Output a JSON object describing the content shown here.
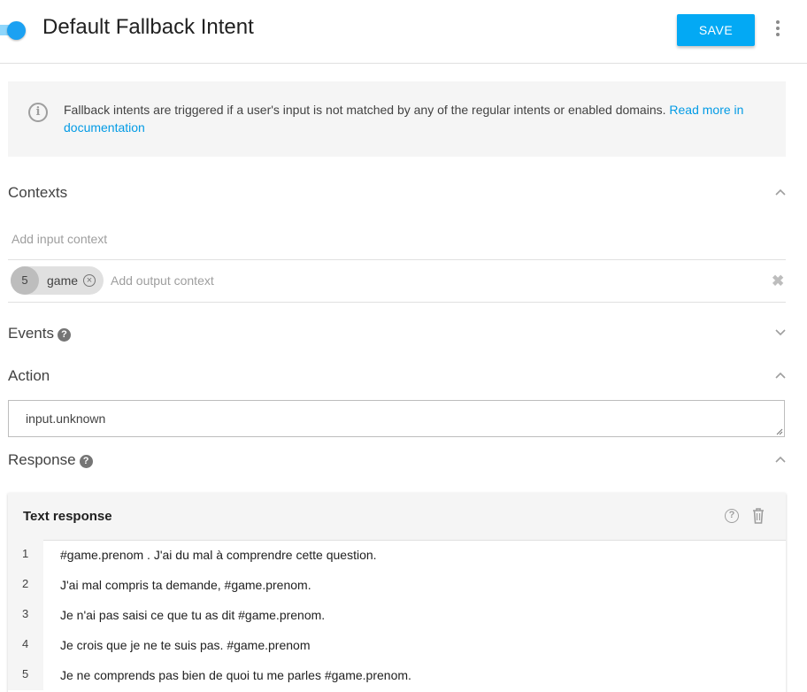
{
  "header": {
    "title": "Default Fallback Intent",
    "enabled": true,
    "save_label": "SAVE",
    "menu_icon": "more-vert-icon"
  },
  "info": {
    "icon": "info-icon",
    "text": "Fallback intents are triggered if a user's input is not matched by any of the regular intents or enabled domains.",
    "link_text": "Read more in documentation"
  },
  "contexts": {
    "title": "Contexts",
    "input_placeholder": "Add input context",
    "output_chip": {
      "lifespan": "5",
      "name": "game"
    },
    "output_placeholder": "Add output context"
  },
  "events": {
    "title": "Events"
  },
  "action": {
    "title": "Action",
    "value": "input.unknown"
  },
  "response": {
    "title": "Response",
    "card_title": "Text response",
    "rows": [
      {
        "num": "1",
        "text": "#game.prenom . J'ai du mal à comprendre cette question."
      },
      {
        "num": "2",
        "text": "J'ai mal compris ta demande, #game.prenom."
      },
      {
        "num": "3",
        "text": "Je n'ai pas saisi ce que tu as dit #game.prenom."
      },
      {
        "num": "4",
        "text": "Je crois que je ne te suis pas. #game.prenom"
      },
      {
        "num": "5",
        "text": "Je ne comprends pas bien de quoi tu me parles #game.prenom."
      }
    ]
  },
  "colors": {
    "accent": "#03a9f4",
    "link": "#039be5",
    "toggle_on": "#1ba1f2"
  }
}
